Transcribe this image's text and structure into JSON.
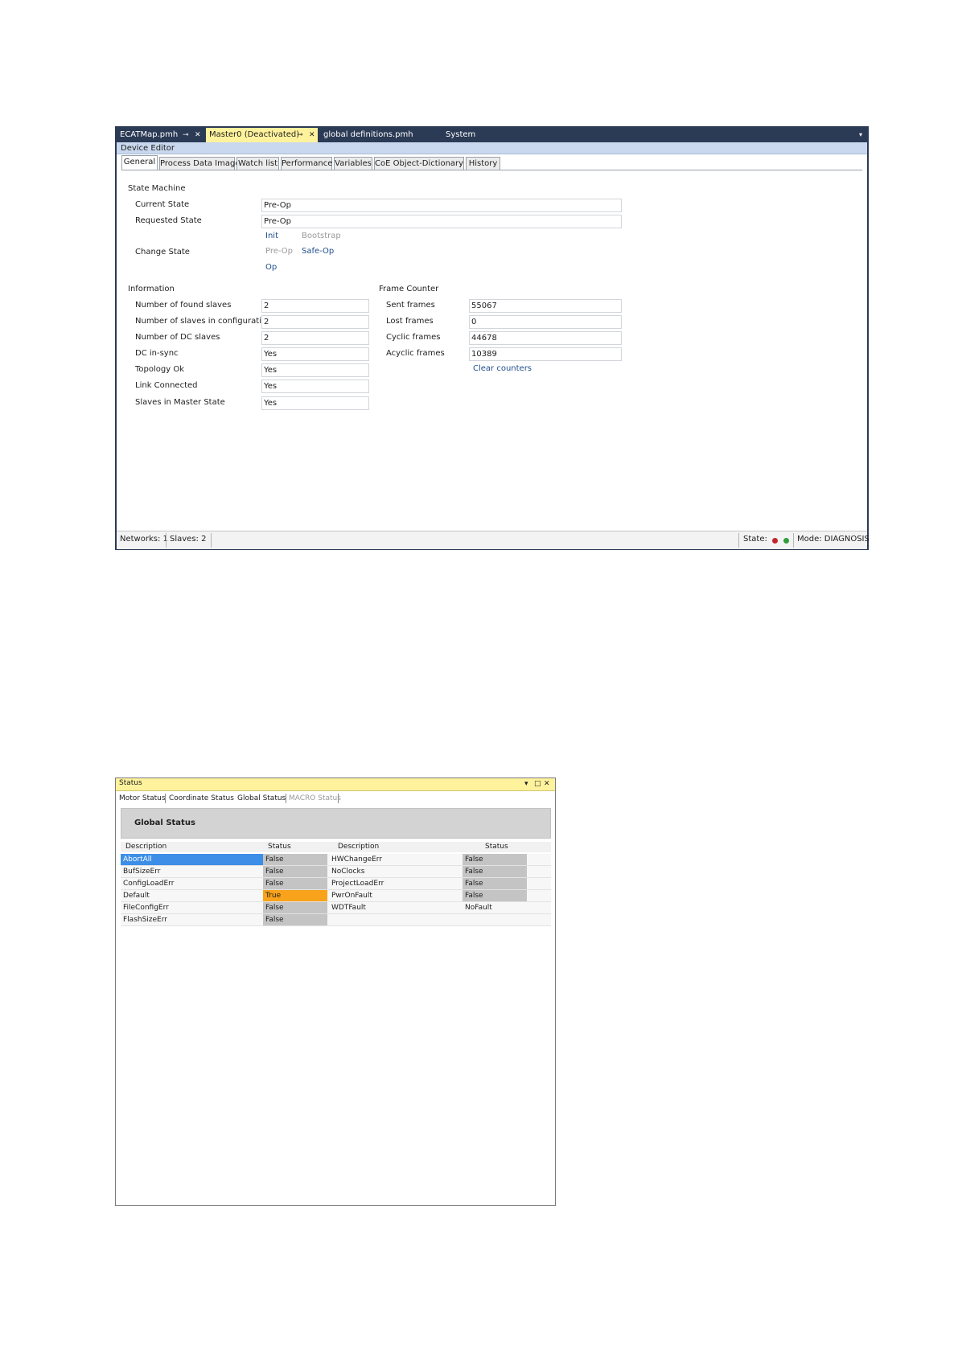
{
  "device_editor": {
    "doc_tabs": [
      {
        "label": "ECATMap.pmh",
        "active": false
      },
      {
        "label": "Master0 (Deactivated)",
        "active": true
      },
      {
        "label": "global definitions.pmh",
        "active": false
      },
      {
        "label": "System",
        "active": false
      }
    ],
    "pin_glyph": "⊸",
    "close_glyph": "✕",
    "menu_glyph": "▾",
    "header": "Device Editor",
    "tabs": [
      "General",
      "Process Data Image",
      "Watch list",
      "Performance",
      "Variables",
      "CoE Object-Dictionary",
      "History"
    ],
    "active_tab": "General",
    "state_machine": {
      "section": "State Machine",
      "current_state_label": "Current State",
      "current_state_value": "Pre-Op",
      "requested_state_label": "Requested State",
      "requested_state_value": "Pre-Op",
      "change_state_label": "Change State",
      "buttons": {
        "init": "Init",
        "bootstrap": "Bootstrap",
        "preop": "Pre-Op",
        "safeop": "Safe-Op",
        "op": "Op"
      }
    },
    "information": {
      "section": "Information",
      "rows": [
        {
          "label": "Number of found slaves",
          "value": "2"
        },
        {
          "label": "Number of slaves in configuration",
          "value": "2"
        },
        {
          "label": "Number of DC slaves",
          "value": "2"
        },
        {
          "label": "DC in-sync",
          "value": "Yes"
        },
        {
          "label": "Topology Ok",
          "value": "Yes"
        },
        {
          "label": "Link Connected",
          "value": "Yes"
        },
        {
          "label": "Slaves in Master State",
          "value": "Yes"
        }
      ]
    },
    "frame_counter": {
      "section": "Frame Counter",
      "rows": [
        {
          "label": "Sent frames",
          "value": "55067"
        },
        {
          "label": "Lost frames",
          "value": "0"
        },
        {
          "label": "Cyclic frames",
          "value": "44678"
        },
        {
          "label": "Acyclic frames",
          "value": "10389"
        }
      ],
      "clear_label": "Clear counters"
    },
    "statusbar": {
      "networks": "Networks: 1",
      "slaves": "Slaves: 2",
      "state_label": "State:",
      "led_colors": [
        "#c0262c",
        "#2f9e3a"
      ],
      "mode": "Mode: DIAGNOSIS"
    }
  },
  "status_window": {
    "title": "Status",
    "menu_glyph": "▾",
    "restore_glyph": "□",
    "close_glyph": "✕",
    "tabs": [
      {
        "label": "Motor Status",
        "disabled": false
      },
      {
        "label": "Coordinate Status",
        "disabled": false
      },
      {
        "label": "Global Status",
        "disabled": false
      },
      {
        "label": "MACRO Status",
        "disabled": true
      }
    ],
    "banner": "Global Status",
    "headers": [
      "Description",
      "Status",
      "Description",
      "Status"
    ],
    "rows": [
      {
        "d1": "AbortAll",
        "s1": "False",
        "d2": "HWChangeErr",
        "s2": "False"
      },
      {
        "d1": "BufSizeErr",
        "s1": "False",
        "d2": "NoClocks",
        "s2": "False"
      },
      {
        "d1": "ConfigLoadErr",
        "s1": "False",
        "d2": "ProjectLoadErr",
        "s2": "False"
      },
      {
        "d1": "Default",
        "s1": "True",
        "d2": "PwrOnFault",
        "s2": "False"
      },
      {
        "d1": "FileConfigErr",
        "s1": "False",
        "d2": "WDTFault",
        "s2": "NoFault"
      },
      {
        "d1": "FlashSizeErr",
        "s1": "False",
        "d2": "",
        "s2": ""
      }
    ],
    "selected_row": 0,
    "status_colors": {
      "false": "#c4c4c4",
      "true": "#f9a21b",
      "selected": "#3d8ee6"
    }
  }
}
